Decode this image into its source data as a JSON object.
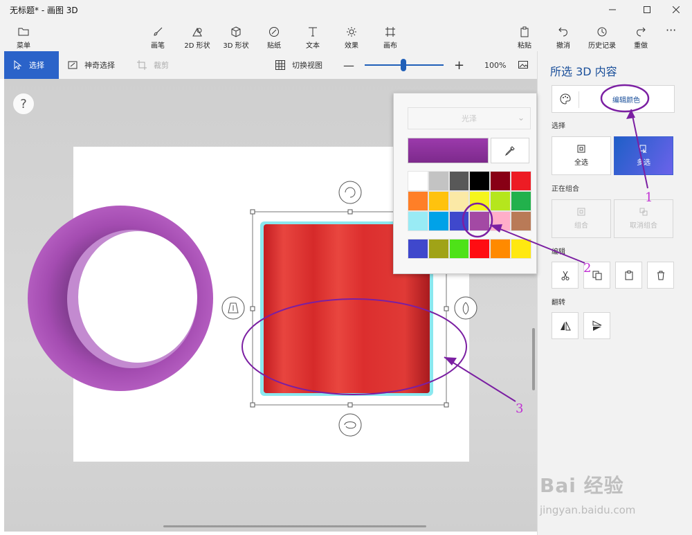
{
  "window": {
    "title": "无标题* - 画图 3D"
  },
  "ribbon": {
    "menu": "菜单",
    "brushes": "画笔",
    "shapes2d": "2D 形状",
    "shapes3d": "3D 形状",
    "stickers": "贴纸",
    "text": "文本",
    "effects": "效果",
    "canvas": "画布",
    "paste": "粘贴",
    "undo": "撤消",
    "history": "历史记录",
    "redo": "重做"
  },
  "toolbar": {
    "select": "选择",
    "magic_select": "神奇选择",
    "crop": "裁剪",
    "switch_view": "切换视图",
    "zoom": "100%"
  },
  "help": "?",
  "panel": {
    "title": "所选 3D 内容",
    "edit_color": "编辑颜色",
    "select_label": "选择",
    "select_all": "全选",
    "multi_select": "多选",
    "grouping_label": "正在组合",
    "group": "组合",
    "ungroup": "取消组合",
    "edit_label": "编辑",
    "flip_label": "翻转"
  },
  "color_picker": {
    "finish": "光泽",
    "current_color": "#9b3aab",
    "swatches": [
      "#ffffff",
      "#c3c3c3",
      "#585858",
      "#000000",
      "#880015",
      "#ed1c24",
      "#ff7f27",
      "#ffc20e",
      "#fbe9a6",
      "#f5f51c",
      "#b5e61d",
      "#22b14c",
      "#99ebf5",
      "#00a2e8",
      "#3f48cc",
      "#a349a4",
      "#ffaec9",
      "#b97a57"
    ],
    "extra_swatches": [
      "#3f48cc",
      "#a0a317",
      "#4ee218",
      "#ff0d12",
      "#ff8a00",
      "#ffe810"
    ]
  },
  "annotations": [
    "1",
    "2",
    "3"
  ],
  "colors": {
    "accent": "#2b63c9",
    "annotation": "#7b1fa2",
    "cylinder": "#e0262b",
    "ring": "#a64bb3"
  },
  "watermark": {
    "brand": "Bai 经验",
    "url": "jingyan.baidu.com"
  }
}
